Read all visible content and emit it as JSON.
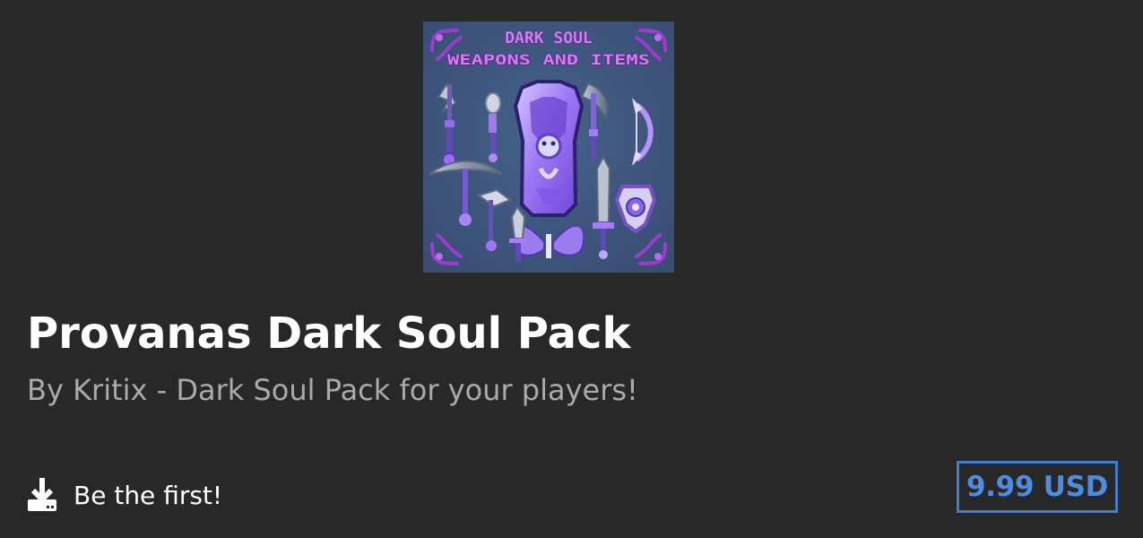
{
  "product": {
    "image_text_line1": "DARK SOUL",
    "image_text_line2": "WEAPONS AND ITEMS",
    "title": "Provanas Dark Soul Pack",
    "subtitle": "By Kritix - Dark Soul Pack for your players!"
  },
  "downloads": {
    "icon": "download-icon",
    "label": "Be the first!"
  },
  "price": {
    "label": "9.99 USD"
  },
  "colors": {
    "background": "#282828",
    "title": "#ffffff",
    "subtitle": "#aaaaaa",
    "price": "#3b7ed6",
    "image_background": "#3e557c",
    "image_accent": "#a77ff5"
  }
}
